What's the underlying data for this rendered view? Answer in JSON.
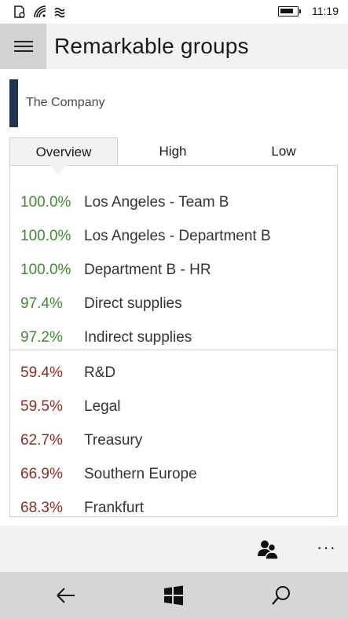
{
  "status": {
    "time": "11:19",
    "battery_level": 0.85,
    "icons": [
      "notification-icon",
      "wifi-icon",
      "signal-icon",
      "battery-icon"
    ]
  },
  "header": {
    "title": "Remarkable groups",
    "menu_icon": "hamburger-icon"
  },
  "company": {
    "label": "The Company",
    "accent_color": "#1f3450"
  },
  "tabs": [
    {
      "label": "Overview",
      "active": true
    },
    {
      "label": "High",
      "active": false
    },
    {
      "label": "Low",
      "active": false
    }
  ],
  "top_groups": [
    {
      "value": "100.0%",
      "name": "Los Angeles - Team B"
    },
    {
      "value": "100.0%",
      "name": "Los Angeles - Department B"
    },
    {
      "value": "100.0%",
      "name": "Department B - HR"
    },
    {
      "value": "97.4%",
      "name": "Direct supplies"
    },
    {
      "value": "97.2%",
      "name": "Indirect supplies"
    }
  ],
  "bottom_groups": [
    {
      "value": "59.4%",
      "name": "R&D"
    },
    {
      "value": "59.5%",
      "name": "Legal"
    },
    {
      "value": "62.7%",
      "name": "Treasury"
    },
    {
      "value": "66.9%",
      "name": "Southern Europe"
    },
    {
      "value": "68.3%",
      "name": "Frankfurt"
    }
  ],
  "colors": {
    "high": "#3f8a32",
    "low": "#8a2d22"
  },
  "command_bar": {
    "people_icon": "people-icon",
    "more_label": "···"
  },
  "nav": {
    "back_icon": "back-arrow-icon",
    "windows_icon": "windows-logo-icon",
    "search_icon": "search-icon"
  }
}
